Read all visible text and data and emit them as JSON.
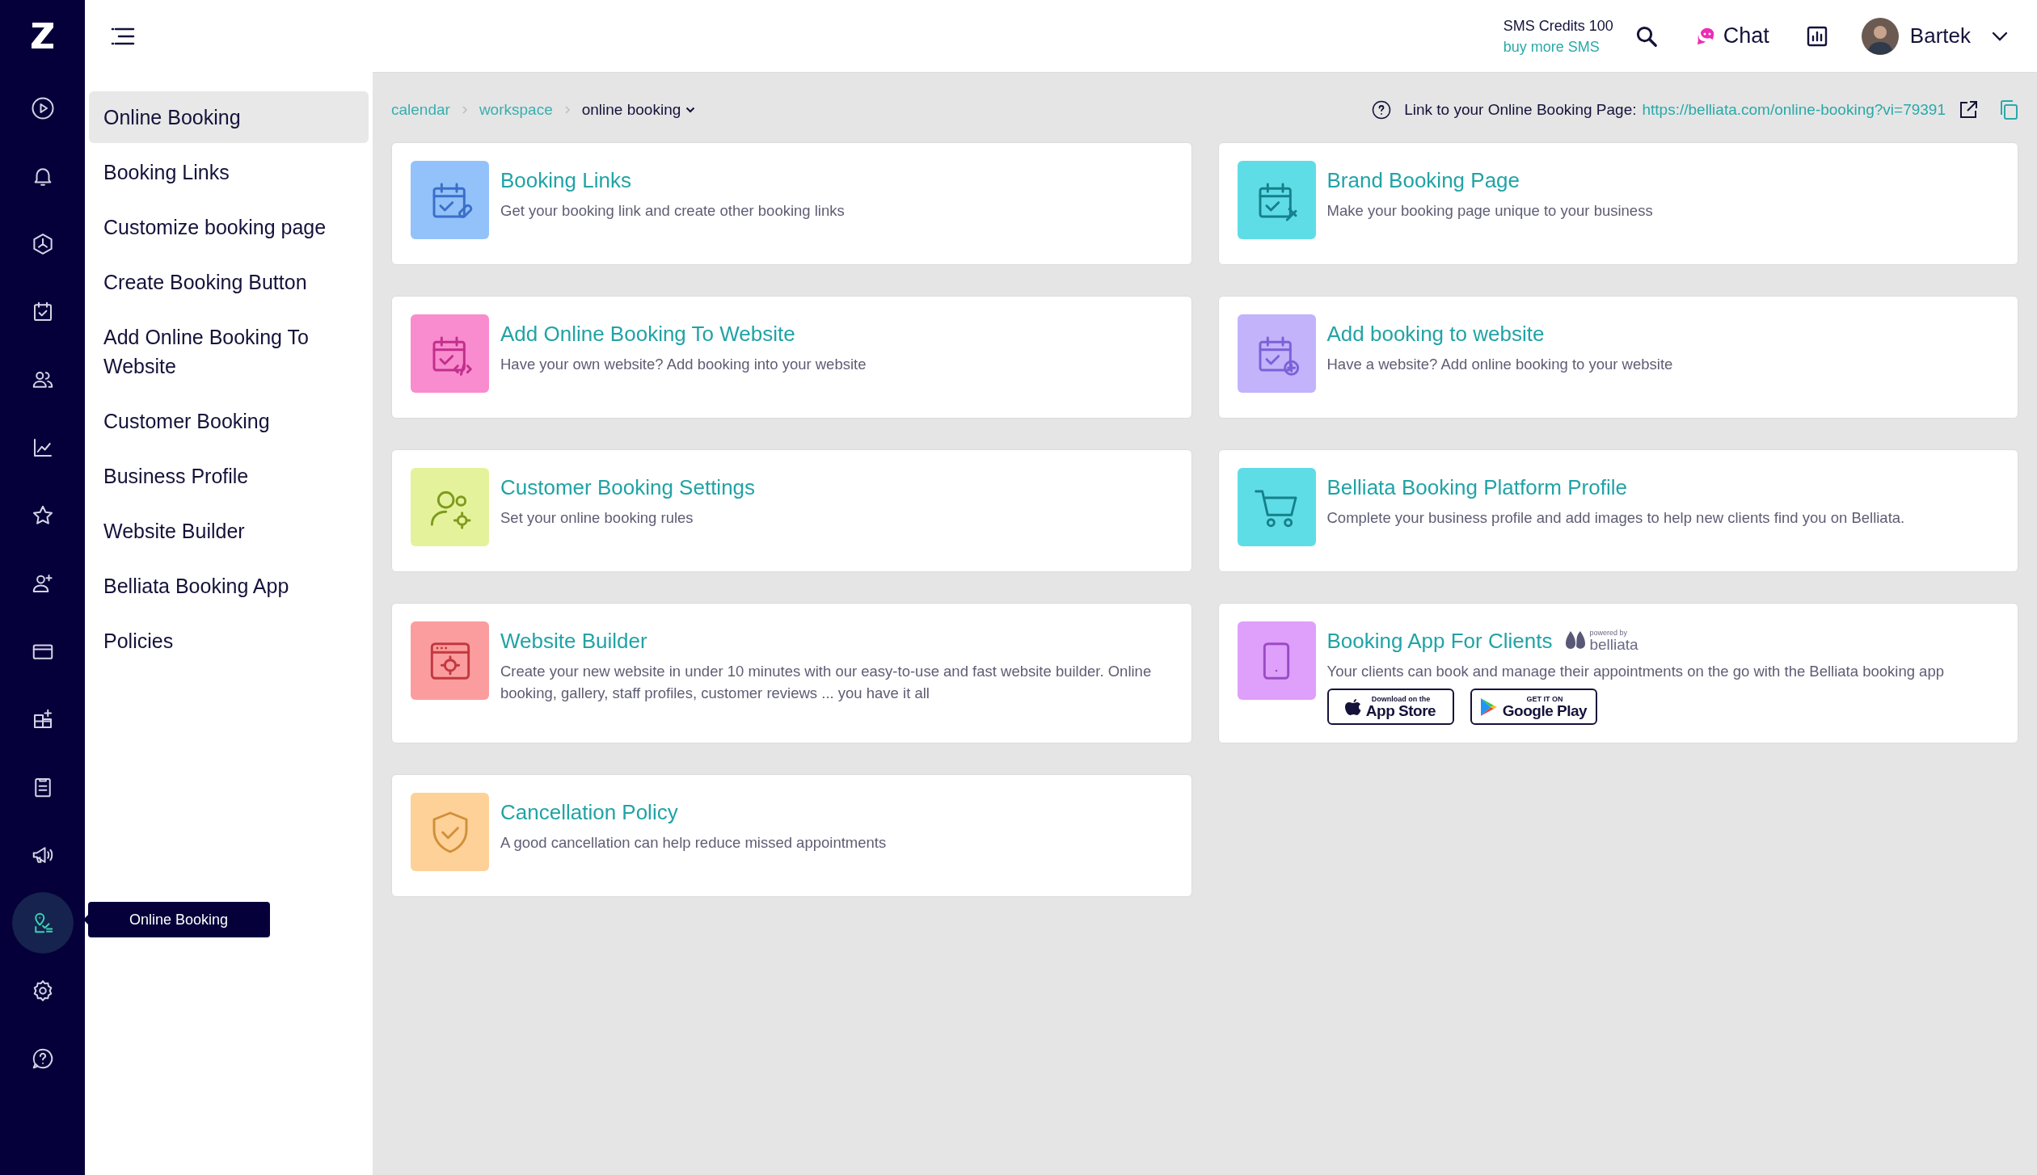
{
  "rail": {
    "items": [
      {
        "selected": false
      },
      {
        "selected": false
      },
      {
        "selected": false
      },
      {
        "selected": false
      },
      {
        "selected": false
      },
      {
        "selected": false
      },
      {
        "selected": false
      },
      {
        "selected": false
      },
      {
        "selected": false
      },
      {
        "selected": false
      },
      {
        "selected": false
      },
      {
        "selected": false
      },
      {
        "selected": true
      },
      {
        "selected": false
      },
      {
        "selected": false
      }
    ],
    "tooltip": "Online Booking"
  },
  "sidebar": {
    "items": [
      {
        "label": "Online Booking",
        "selected": true
      },
      {
        "label": "Booking Links",
        "selected": false
      },
      {
        "label": "Customize booking page",
        "selected": false
      },
      {
        "label": "Create Booking Button",
        "selected": false
      },
      {
        "label": "Add Online Booking To Website",
        "selected": false
      },
      {
        "label": "Customer Booking",
        "selected": false
      },
      {
        "label": "Business Profile",
        "selected": false
      },
      {
        "label": "Website Builder",
        "selected": false
      },
      {
        "label": "Belliata Booking App",
        "selected": false
      },
      {
        "label": "Policies",
        "selected": false
      }
    ]
  },
  "top_bar": {
    "sms_credits": "SMS Credits 100",
    "buy_sms": "buy more SMS",
    "chat": "Chat",
    "user": "Bartek"
  },
  "breadcrumb": {
    "items": [
      "calendar",
      "workspace"
    ],
    "current": "online booking"
  },
  "booking_link": {
    "label": "Link to your Online Booking Page:",
    "url": "https://belliata.com/online-booking?vi=79391"
  },
  "cards": [
    {
      "title": "Booking Links",
      "description": "Get your booking link and create other booking links",
      "color": "#93c2fa"
    },
    {
      "title": "Brand Booking Page",
      "description": "Make your booking page unique to your business",
      "color": "#5fdde6"
    },
    {
      "title": "Add Online Booking To Website",
      "description": "Have your own website? Add booking into your website",
      "color": "#f98ccf"
    },
    {
      "title": "Add booking to website",
      "description": "Have a website? Add online booking to your website",
      "color": "#c2b3fb"
    },
    {
      "title": "Customer Booking Settings",
      "description": "Set your online booking rules",
      "color": "#e4f39b"
    },
    {
      "title": "Belliata Booking Platform Profile",
      "description": "Complete your business profile and add images to help new clients find you on Belliata.",
      "color": "#5fdde6"
    },
    {
      "title": "Website Builder",
      "description": "Create your new website in under 10 minutes with our easy-to-use and fast website builder. Online booking, gallery, staff profiles, customer reviews ... you have it all",
      "color": "#fb9d9e"
    },
    {
      "title": "Booking App For Clients",
      "description": "Your clients can book and manage their appointments on the go with the Belliata booking app",
      "color": "#dea0fb",
      "kind": "app",
      "powered_by": "powered by",
      "brand": "belliata",
      "stores": [
        {
          "small": "Download on the",
          "big": "App Store",
          "kind": "apple"
        },
        {
          "small": "GET IT ON",
          "big": "Google Play",
          "kind": "google"
        }
      ]
    },
    {
      "title": "Cancellation Policy",
      "description": "A good cancellation can help reduce missed appointments",
      "color": "#fdd197"
    }
  ]
}
